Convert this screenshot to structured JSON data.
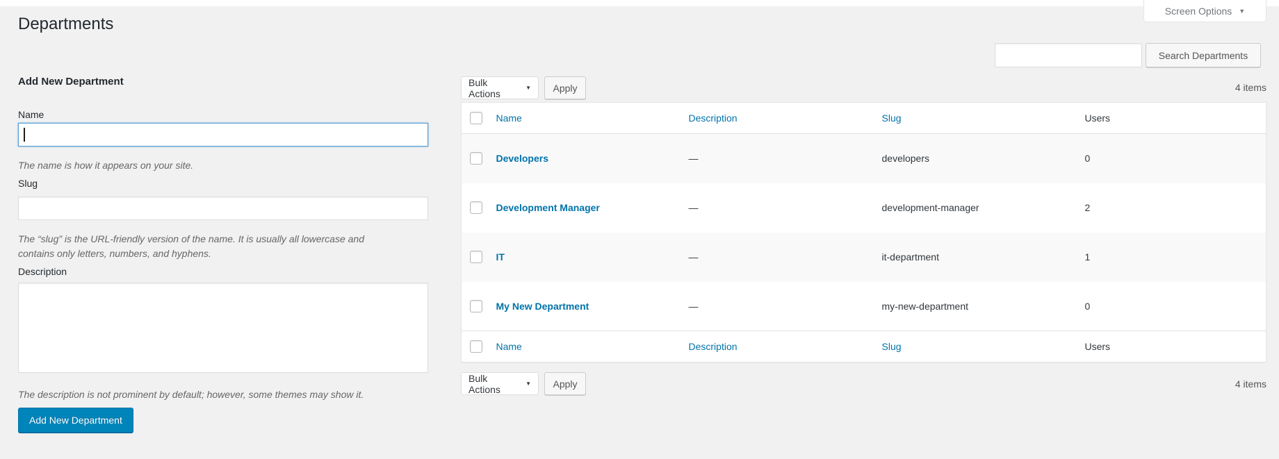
{
  "page": {
    "title": "Departments"
  },
  "screen_options": {
    "label": "Screen Options"
  },
  "search": {
    "value": "",
    "button_label": "Search Departments"
  },
  "form": {
    "heading": "Add New Department",
    "name": {
      "label": "Name",
      "value": "",
      "help": "The name is how it appears on your site."
    },
    "slug": {
      "label": "Slug",
      "value": "",
      "help": "The “slug” is the URL-friendly version of the name. It is usually all lowercase and contains only letters, numbers, and hyphens."
    },
    "description": {
      "label": "Description",
      "value": "",
      "help": "The description is not prominent by default; however, some themes may show it."
    },
    "submit_label": "Add New Department"
  },
  "toolbar": {
    "bulk_actions_label": "Bulk Actions",
    "apply_label": "Apply",
    "items_count": "4 items"
  },
  "table": {
    "columns": [
      {
        "label": "Name"
      },
      {
        "label": "Description"
      },
      {
        "label": "Slug"
      },
      {
        "label": "Users"
      }
    ],
    "rows": [
      {
        "name": "Developers",
        "description": "—",
        "slug": "developers",
        "users": "0"
      },
      {
        "name": "Development Manager",
        "description": "—",
        "slug": "development-manager",
        "users": "2"
      },
      {
        "name": "IT",
        "description": "—",
        "slug": "it-department",
        "users": "1"
      },
      {
        "name": "My New Department",
        "description": "—",
        "slug": "my-new-department",
        "users": "0"
      }
    ]
  },
  "colors": {
    "background": "#f1f1f1",
    "link": "#0073aa",
    "primary_button": "#0085ba",
    "focus_border": "#5b9dd9",
    "stripe_row": "#f9f9f9"
  }
}
